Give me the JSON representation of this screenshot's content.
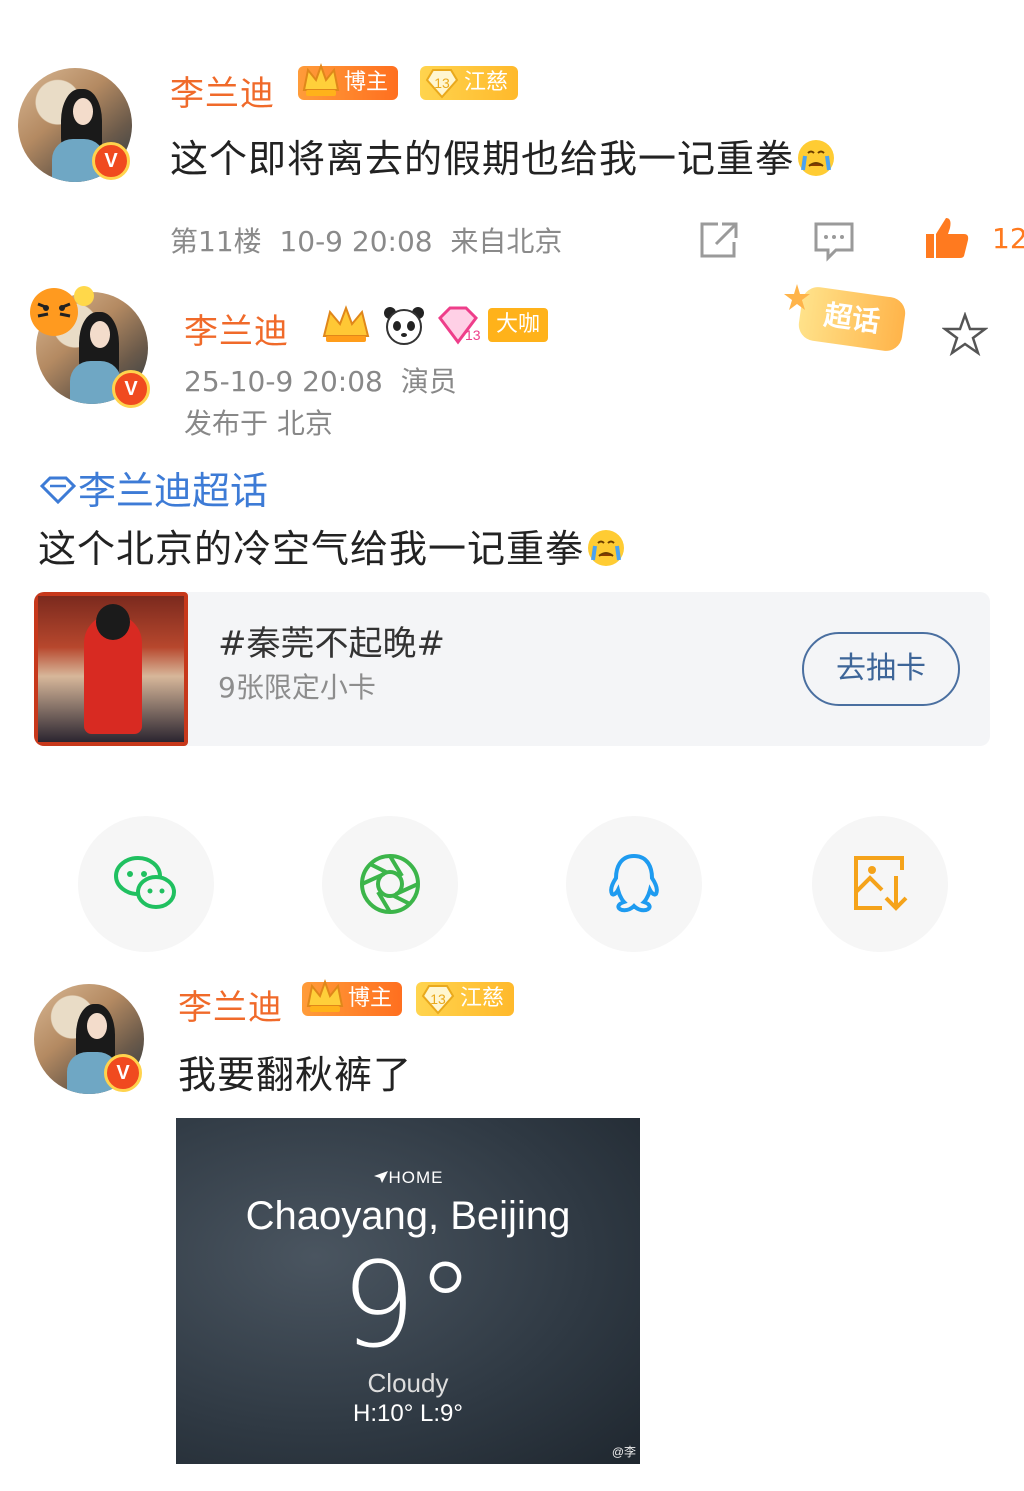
{
  "comment1": {
    "author": "李兰迪",
    "badge_role": "博主",
    "badge_level_num": "13",
    "badge_level_label": "江慈",
    "text": "这个即将离去的假期也给我一记重拳",
    "floor": "第11楼",
    "time": "10-9 20:08",
    "location": "来自北京",
    "like_count": "12"
  },
  "post": {
    "author": "李兰迪",
    "level_num": "13",
    "badge_big": "大咖",
    "time": "25-10-9 20:08",
    "role": "演员",
    "location": "发布于 北京",
    "supertopic_tag": "超话",
    "supertopic": "李兰迪超话",
    "text": "这个北京的冷空气给我一记重拳",
    "promo": {
      "title": "#秦莞不起晚#",
      "subtitle": "9张限定小卡",
      "button": "去抽卡"
    }
  },
  "share_icons": [
    "wechat-icon",
    "moments-icon",
    "qq-icon",
    "save-image-icon"
  ],
  "comment2": {
    "author": "李兰迪",
    "badge_role": "博主",
    "badge_level_num": "13",
    "badge_level_label": "江慈",
    "text": "我要翻秋裤了"
  },
  "weather": {
    "home": "HOME",
    "city": "Chaoyang, Beijing",
    "temp": "9°",
    "condition": "Cloudy",
    "hilo": "H:10°  L:9°",
    "watermark": "@李"
  },
  "colors": {
    "name_orange": "#f06a2a",
    "link_blue": "#3d7bd6",
    "like_orange": "#ff7a1f"
  }
}
